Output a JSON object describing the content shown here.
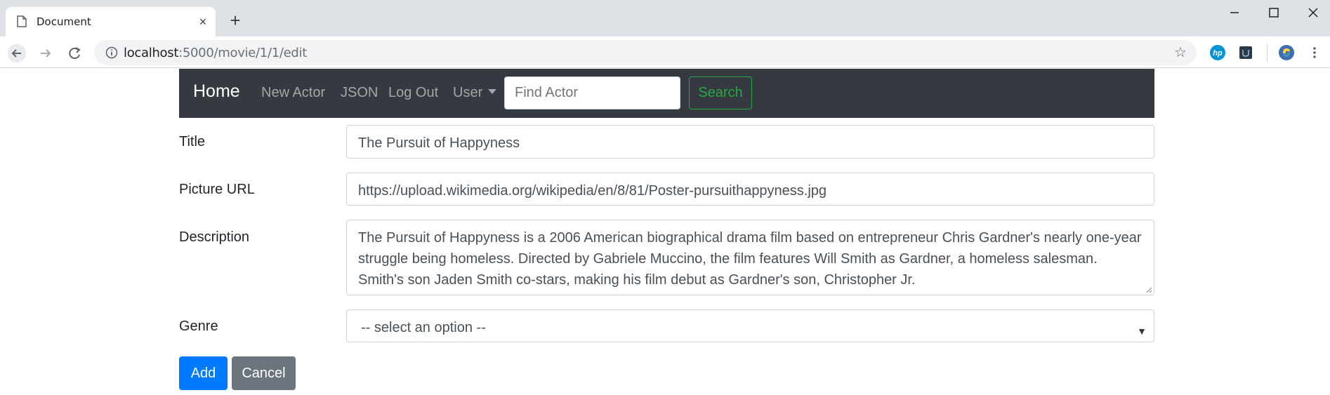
{
  "browser": {
    "tab_title": "Document",
    "tab_close": "×",
    "new_tab": "+",
    "url_host": "localhost",
    "url_path": ":5000/movie/1/1/edit",
    "star": "☆"
  },
  "navbar": {
    "brand": "Home",
    "links": [
      "New Actor",
      "JSON",
      "Log Out",
      "User"
    ],
    "search_placeholder": "Find Actor",
    "search_button": "Search"
  },
  "form": {
    "title_label": "Title",
    "title_value": "The Pursuit of Happyness",
    "picture_label": "Picture URL",
    "picture_value": "https://upload.wikimedia.org/wikipedia/en/8/81/Poster-pursuithappyness.jpg",
    "description_label": "Description",
    "description_value": "The Pursuit of Happyness is a 2006 American biographical drama film based on entrepreneur Chris Gardner's nearly one-year struggle being homeless. Directed by Gabriele Muccino, the film features Will Smith as Gardner, a homeless salesman. Smith's son Jaden Smith co-stars, making his film debut as Gardner's son, Christopher Jr.",
    "genre_label": "Genre",
    "genre_selected": "-- select an option --",
    "add_button": "Add",
    "cancel_button": "Cancel"
  },
  "colors": {
    "navbar_bg": "#343a40",
    "primary": "#007bff",
    "secondary": "#6c757d",
    "success": "#28a745"
  }
}
